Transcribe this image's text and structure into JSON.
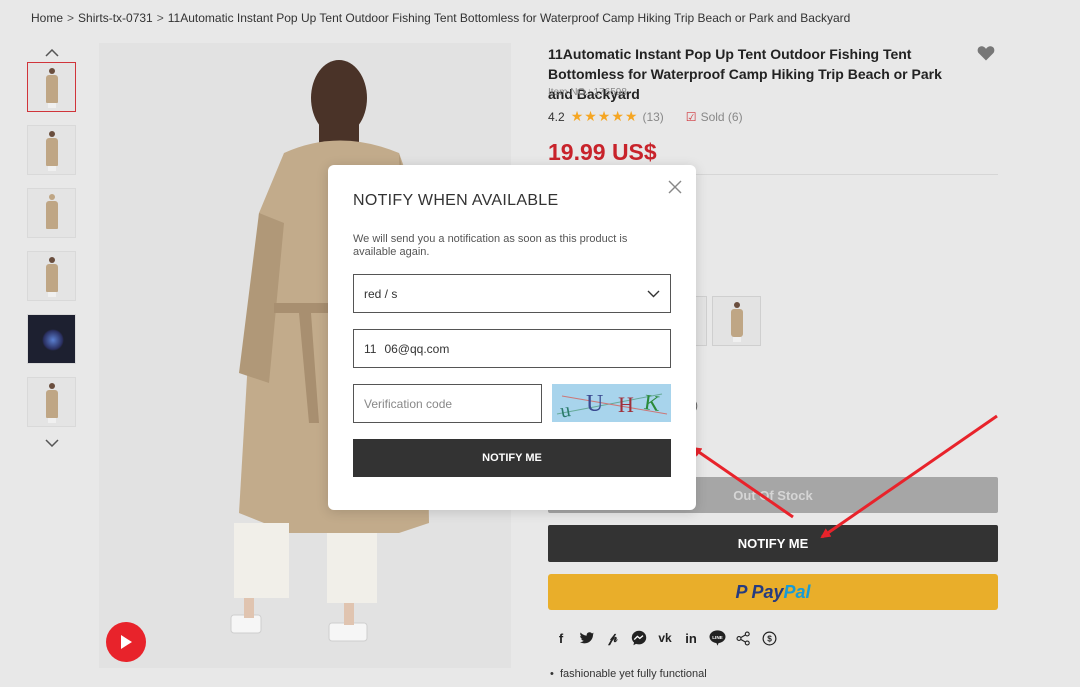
{
  "breadcrumb": {
    "home": "Home",
    "category": "Shirts-tx-0731",
    "current": "11Automatic Instant Pop Up Tent Outdoor Fishing Tent Bottomless for Waterproof Camp Hiking Trip Beach or Park and Backyard",
    "separator": ">"
  },
  "product": {
    "title": "11Automatic Instant Pop Up Tent Outdoor Fishing Tent Bottomless for Waterproof Camp Hiking Trip Beach or Park and Backyard",
    "item_no": "Item NO.: 176598",
    "rating": "4.2",
    "stars": "★★★★★",
    "review_count": "(13)",
    "sold": "Sold (6)",
    "price": "19.99 US$",
    "qty_paren": ")"
  },
  "buttons": {
    "out_of_stock": "Out Of Stock",
    "notify_me": "NOTIFY ME",
    "paypal_pay": "Pay",
    "paypal_pal": "Pal"
  },
  "share_icons": [
    "facebook-icon",
    "twitter-icon",
    "pinterest-icon",
    "messenger-icon",
    "vk-icon",
    "linkedin-icon",
    "line-icon",
    "share-icon",
    "coin-icon"
  ],
  "features": {
    "bullet_1": "fashionable yet fully functional"
  },
  "modal": {
    "title": "NOTIFY WHEN AVAILABLE",
    "description": "We will send you a notification as soon as this product is available again.",
    "variant_value": "red / s",
    "email_value": "11    06@qq.com",
    "verify_placeholder": "Verification code",
    "captcha_text": "UUHK",
    "submit_label": "NOTIFY ME"
  },
  "colors": {
    "accent_red": "#c8232b",
    "dark_button": "#333333",
    "paypal_yellow": "#e9ae2a",
    "arrow_red": "#e8232b",
    "star": "#f5a623"
  }
}
